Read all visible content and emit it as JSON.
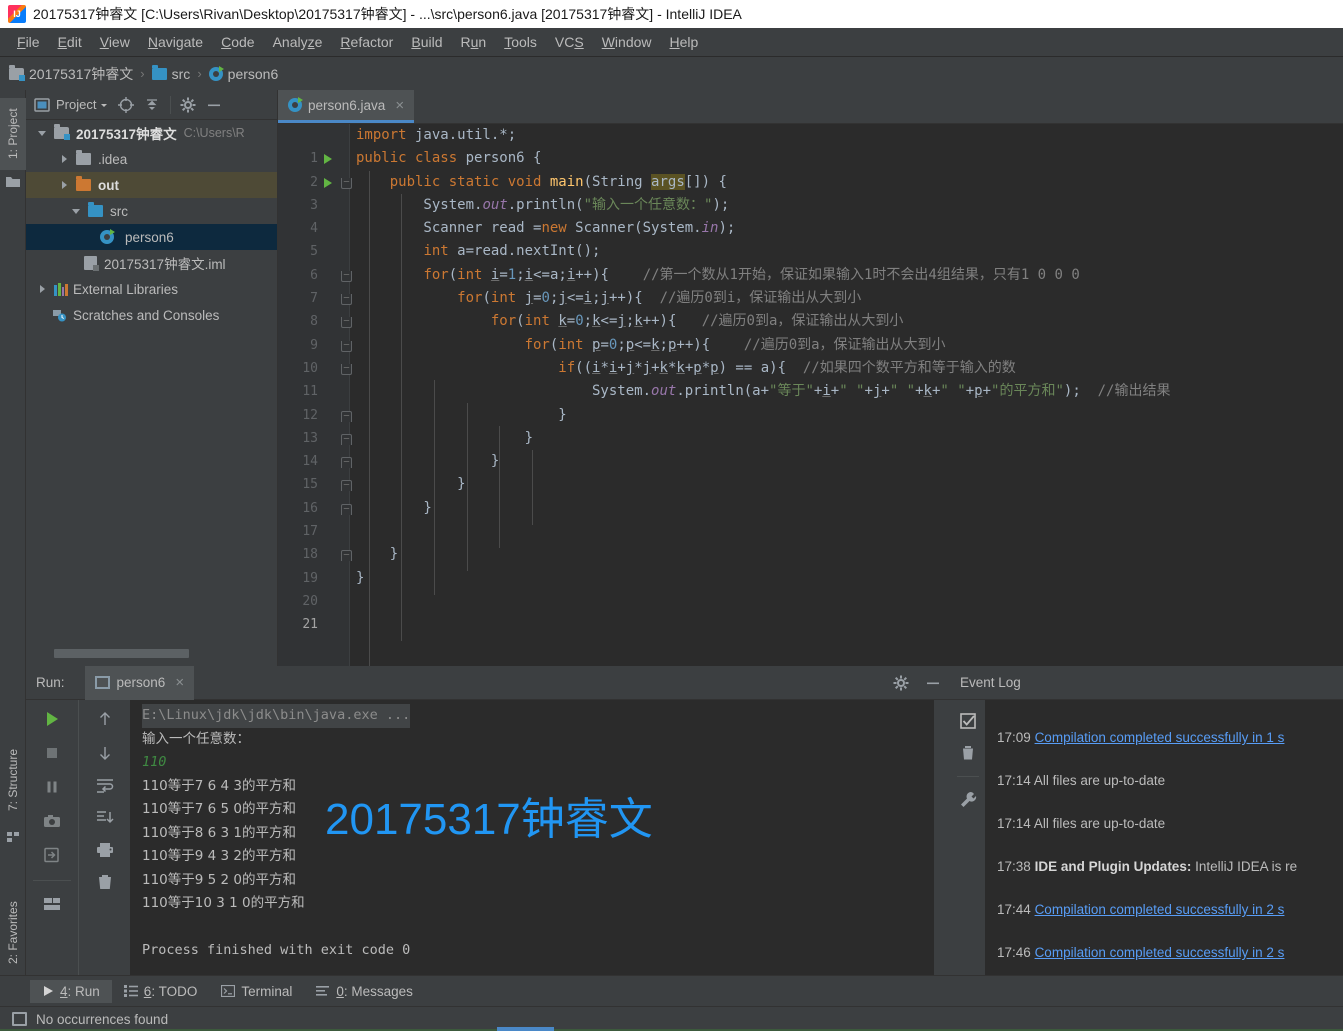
{
  "window": {
    "title": "20175317钟睿文 [C:\\Users\\Rivan\\Desktop\\20175317钟睿文] - ...\\src\\person6.java [20175317钟睿文] - IntelliJ IDEA",
    "logo_icon": "intellij-idea-logo"
  },
  "menubar": {
    "items": [
      {
        "label": "File"
      },
      {
        "label": "Edit"
      },
      {
        "label": "View"
      },
      {
        "label": "Navigate"
      },
      {
        "label": "Code"
      },
      {
        "label": "Analyze"
      },
      {
        "label": "Refactor"
      },
      {
        "label": "Build"
      },
      {
        "label": "Run"
      },
      {
        "label": "Tools"
      },
      {
        "label": "VCS"
      },
      {
        "label": "Window"
      },
      {
        "label": "Help"
      }
    ]
  },
  "breadcrumb": {
    "items": [
      {
        "label": "20175317钟睿文",
        "icon": "module-folder-icon"
      },
      {
        "label": "src",
        "icon": "source-folder-icon"
      },
      {
        "label": "person6",
        "icon": "java-class-icon"
      }
    ],
    "separator": "›"
  },
  "left_stripe": {
    "top_button": {
      "label": "1: Project",
      "icon": "project-icon"
    },
    "bottom_buttons": [
      {
        "label": "7: Structure",
        "icon": "structure-icon"
      },
      {
        "label": "2: Favorites",
        "icon": "star-icon"
      }
    ]
  },
  "project_panel": {
    "title": "Project",
    "toolbar_icons": [
      "locate-icon",
      "collapse-all-icon",
      "gear-icon",
      "minimize-icon"
    ],
    "tree": [
      {
        "label": "20175317钟睿文",
        "sub": "C:\\Users\\R",
        "icon": "module-folder-icon",
        "arrow": "down",
        "indent": 0,
        "state": "normal"
      },
      {
        "label": ".idea",
        "sub": "",
        "icon": "gray-folder-icon",
        "arrow": "right",
        "indent": 1,
        "state": "normal"
      },
      {
        "label": "out",
        "sub": "",
        "icon": "orange-folder-icon",
        "arrow": "right",
        "indent": 1,
        "state": "olive"
      },
      {
        "label": "src",
        "sub": "",
        "icon": "source-folder-icon",
        "arrow": "down",
        "indent": 1,
        "state": "normal"
      },
      {
        "label": "person6",
        "sub": "",
        "icon": "java-class-icon",
        "arrow": "none",
        "indent": 2,
        "state": "selected"
      },
      {
        "label": "20175317钟睿文.iml",
        "sub": "",
        "icon": "iml-file-icon",
        "arrow": "none",
        "indent": 1,
        "state": "normal"
      },
      {
        "label": "External Libraries",
        "sub": "",
        "icon": "library-icon",
        "arrow": "right",
        "indent": 0,
        "state": "normal"
      },
      {
        "label": "Scratches and Consoles",
        "sub": "",
        "icon": "scratches-icon",
        "arrow": "none",
        "indent": 0,
        "state": "normal"
      }
    ]
  },
  "editor": {
    "tab": {
      "label": "person6.java",
      "icon": "java-class-icon",
      "close": "×"
    },
    "lines": [
      {
        "n": "1",
        "gutter": "",
        "fold": "",
        "indent": 0
      },
      {
        "n": "2",
        "gutter": "run",
        "fold": "",
        "indent": 0
      },
      {
        "n": "3",
        "gutter": "run",
        "fold": "open",
        "indent": 0
      },
      {
        "n": "4",
        "gutter": "",
        "fold": "",
        "indent": 1
      },
      {
        "n": "5",
        "gutter": "",
        "fold": "",
        "indent": 1
      },
      {
        "n": "6",
        "gutter": "",
        "fold": "",
        "indent": 1
      },
      {
        "n": "7",
        "gutter": "",
        "fold": "open",
        "indent": 1
      },
      {
        "n": "8",
        "gutter": "",
        "fold": "open",
        "indent": 2
      },
      {
        "n": "9",
        "gutter": "",
        "fold": "open",
        "indent": 3
      },
      {
        "n": "10",
        "gutter": "",
        "fold": "open",
        "indent": 4
      },
      {
        "n": "11",
        "gutter": "",
        "fold": "open",
        "indent": 5
      },
      {
        "n": "12",
        "gutter": "",
        "fold": "",
        "indent": 6
      },
      {
        "n": "13",
        "gutter": "",
        "fold": "closed",
        "indent": 5
      },
      {
        "n": "14",
        "gutter": "",
        "fold": "closed",
        "indent": 4
      },
      {
        "n": "15",
        "gutter": "",
        "fold": "closed",
        "indent": 3
      },
      {
        "n": "16",
        "gutter": "",
        "fold": "closed",
        "indent": 2
      },
      {
        "n": "17",
        "gutter": "",
        "fold": "closed",
        "indent": 1
      },
      {
        "n": "18",
        "gutter": "",
        "fold": "",
        "indent": 0
      },
      {
        "n": "19",
        "gutter": "",
        "fold": "closed",
        "indent": 0
      },
      {
        "n": "20",
        "gutter": "",
        "fold": "",
        "indent": 0
      },
      {
        "n": "21",
        "gutter": "",
        "fold": "",
        "indent": 0
      }
    ],
    "code_text": {
      "l1": "import java.util.*;",
      "l2": "public class person6 {",
      "l3": "public static void main(String args[]) {",
      "l4": "System.out.println(\"输入一个任意数：\");",
      "l5": "Scanner read =new Scanner(System.in);",
      "l6": "int a=read.nextInt();",
      "l7": "for(int i=1;i<=a;i++){    //第一个数从1开始，保证如果输入1时不会出4组结果，只有1 0 0 0",
      "l8": "for(int j=0;j<=i;j++){  //遍历0到i，保证输出从大到小",
      "l9": "for(int k=0;k<=j;k++){   //遍历0到a，保证输出从大到小",
      "l10": "for(int p=0;p<=k;p++){    //遍历0到a，保证输出从大到小",
      "l11": "if((i*i+j*j+k*k+p*p) == a){  //如果四个数平方和等于输入的数",
      "l12": "System.out.println(a+\"等于\"+i+\" \"+j+\" \"+k+\" \"+p+\"的平方和\");  //输出结果",
      "l13": "}",
      "l14": "}",
      "l15": "}",
      "l16": "}",
      "l17": "}",
      "l18": "",
      "l19": "}",
      "l20": "}",
      "l21": ""
    }
  },
  "run_panel": {
    "label": "Run:",
    "tab_label": "person6",
    "tab_close": "×",
    "header_icons": [
      "gear-icon",
      "minimize-icon"
    ],
    "toolbar_left": [
      "rerun-icon",
      "stop-icon",
      "pause-icon",
      "camera-icon",
      "export-icon",
      "layout-icon"
    ],
    "toolbar_right": [
      "up-icon",
      "down-icon",
      "soft-wrap-icon",
      "scroll-to-end-icon",
      "print-icon",
      "trash-icon"
    ],
    "console": [
      {
        "text": "E:\\Linux\\jdk\\jdk\\bin\\java.exe ...",
        "style": "cmd"
      },
      {
        "text": "输入一个任意数：",
        "style": "cn"
      },
      {
        "text": "110",
        "style": "input"
      },
      {
        "text": "110等于7 6 4 3的平方和",
        "style": "cn"
      },
      {
        "text": "110等于7 6 5 0的平方和",
        "style": "cn"
      },
      {
        "text": "110等于8 6 3 1的平方和",
        "style": "cn"
      },
      {
        "text": "110等于9 4 3 2的平方和",
        "style": "cn"
      },
      {
        "text": "110等于9 5 2 0的平方和",
        "style": "cn"
      },
      {
        "text": "110等于10 3 1 0的平方和",
        "style": "cn"
      },
      {
        "text": "",
        "style": "plain"
      },
      {
        "text": "Process finished with exit code 0",
        "style": "plain"
      }
    ],
    "watermark": "20175317钟睿文",
    "watermark_color": "#2196f3"
  },
  "event_log": {
    "title": "Event Log",
    "tools": [
      "mark-read-icon",
      "trash-icon",
      "settings-wrench-icon"
    ],
    "entries": [
      {
        "time": "17:09",
        "text": "Compilation completed successfully in 1 s",
        "style": "link"
      },
      {
        "time": "17:14",
        "text": "All files are up-to-date",
        "style": "plain"
      },
      {
        "time": "17:14",
        "text": "All files are up-to-date",
        "style": "plain"
      },
      {
        "time": "17:38",
        "bold": "IDE and Plugin Updates:",
        "text": " IntelliJ IDEA is re",
        "style": "bold"
      },
      {
        "time": "17:44",
        "text": "Compilation completed successfully in 2 s",
        "style": "link"
      },
      {
        "time": "17:46",
        "text": "Compilation completed successfully in 2 s",
        "style": "link"
      }
    ]
  },
  "bottom_bar": {
    "items": [
      {
        "label": "4: Run",
        "icon": "run-icon",
        "active": true
      },
      {
        "label": "6: TODO",
        "icon": "todo-icon",
        "active": false
      },
      {
        "label": "Terminal",
        "icon": "terminal-icon",
        "active": false
      },
      {
        "label": "0: Messages",
        "icon": "messages-icon",
        "active": false
      }
    ]
  },
  "status_bar": {
    "text": "No occurrences found",
    "icon": "window-icon"
  }
}
